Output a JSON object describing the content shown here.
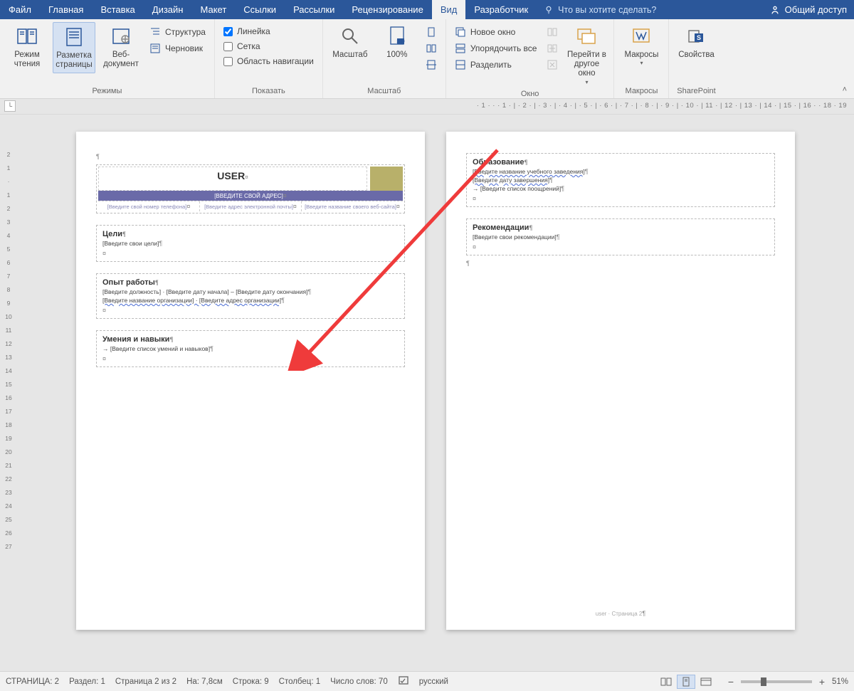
{
  "tabs": {
    "file": "Файл",
    "home": "Главная",
    "insert": "Вставка",
    "design": "Дизайн",
    "layout": "Макет",
    "references": "Ссылки",
    "mailings": "Рассылки",
    "review": "Рецензирование",
    "view": "Вид",
    "developer": "Разработчик",
    "tell_me": "Что вы хотите сделать?",
    "share": "Общий доступ"
  },
  "ribbon": {
    "modes": {
      "label": "Режимы",
      "read": "Режим чтения",
      "print_layout": "Разметка страницы",
      "web_layout": "Веб-документ",
      "outline": "Структура",
      "draft": "Черновик"
    },
    "show": {
      "label": "Показать",
      "ruler": "Линейка",
      "gridlines": "Сетка",
      "nav_pane": "Область навигации"
    },
    "zoom": {
      "label": "Масштаб",
      "zoom": "Масштаб",
      "hundred": "100%"
    },
    "window": {
      "label": "Окно",
      "new_window": "Новое окно",
      "arrange_all": "Упорядочить все",
      "split": "Разделить",
      "switch": "Перейти в другое окно"
    },
    "macros": {
      "label": "Макросы",
      "macros": "Макросы"
    },
    "sharepoint": {
      "label": "SharePoint",
      "properties": "Свойства"
    }
  },
  "ruler": {
    "horizontal": "· 1 ·  ·  · 1 · | · 2 · | · 3 · | · 4 · | · 5 · | · 6 · | · 7 · | · 8 · | · 9 · | · 10 · | 11 · | 12 · | 13 · | 14 · | 15 · | 16 ·   · 18 · 19",
    "vertical": [
      "2",
      "1",
      "·",
      "1",
      "2",
      "3",
      "4",
      "5",
      "6",
      "7",
      "8",
      "9",
      "10",
      "11",
      "12",
      "13",
      "14",
      "15",
      "16",
      "17",
      "18",
      "19",
      "20",
      "21",
      "22",
      "23",
      "24",
      "25",
      "26",
      "27"
    ]
  },
  "doc": {
    "page1": {
      "title": "USER",
      "addr_placeholder": "[ВВЕДИТЕ СВОЙ АДРЕС]",
      "contacts": [
        "[Введите свой номер телефона]",
        "[Введите адрес электронной почты]",
        "[Введите название своего веб-сайта]"
      ],
      "goals_h": "Цели",
      "goals_p": "[Введите свои цели]",
      "exp_h": "Опыт работы",
      "exp_p1": "[Введите должность]  ·  [Введите дату начала] – [Введите дату окончания]",
      "exp_p2": "[Введите название организации]  ·  [Введите адрес организации]",
      "skills_h": "Умения и навыки",
      "skills_p": "→ [Введите список умений и навыков]"
    },
    "page2": {
      "edu_h": "Образование",
      "edu_p1": "[Введите название учебного заведения]",
      "edu_p2": "[Введите дату завершения]",
      "edu_p3": "→ [Введите список поощрений]",
      "ref_h": "Рекомендации",
      "ref_p": "[Введите свои рекомендации]",
      "footer": "user · Страница 2"
    }
  },
  "status": {
    "page": "СТРАНИЦА: 2",
    "section": "Раздел: 1",
    "page_of": "Страница 2 из 2",
    "at": "На: 7,8см",
    "line": "Строка: 9",
    "column": "Столбец: 1",
    "words": "Число слов: 70",
    "lang": "русский",
    "zoom_pct": "51%"
  }
}
